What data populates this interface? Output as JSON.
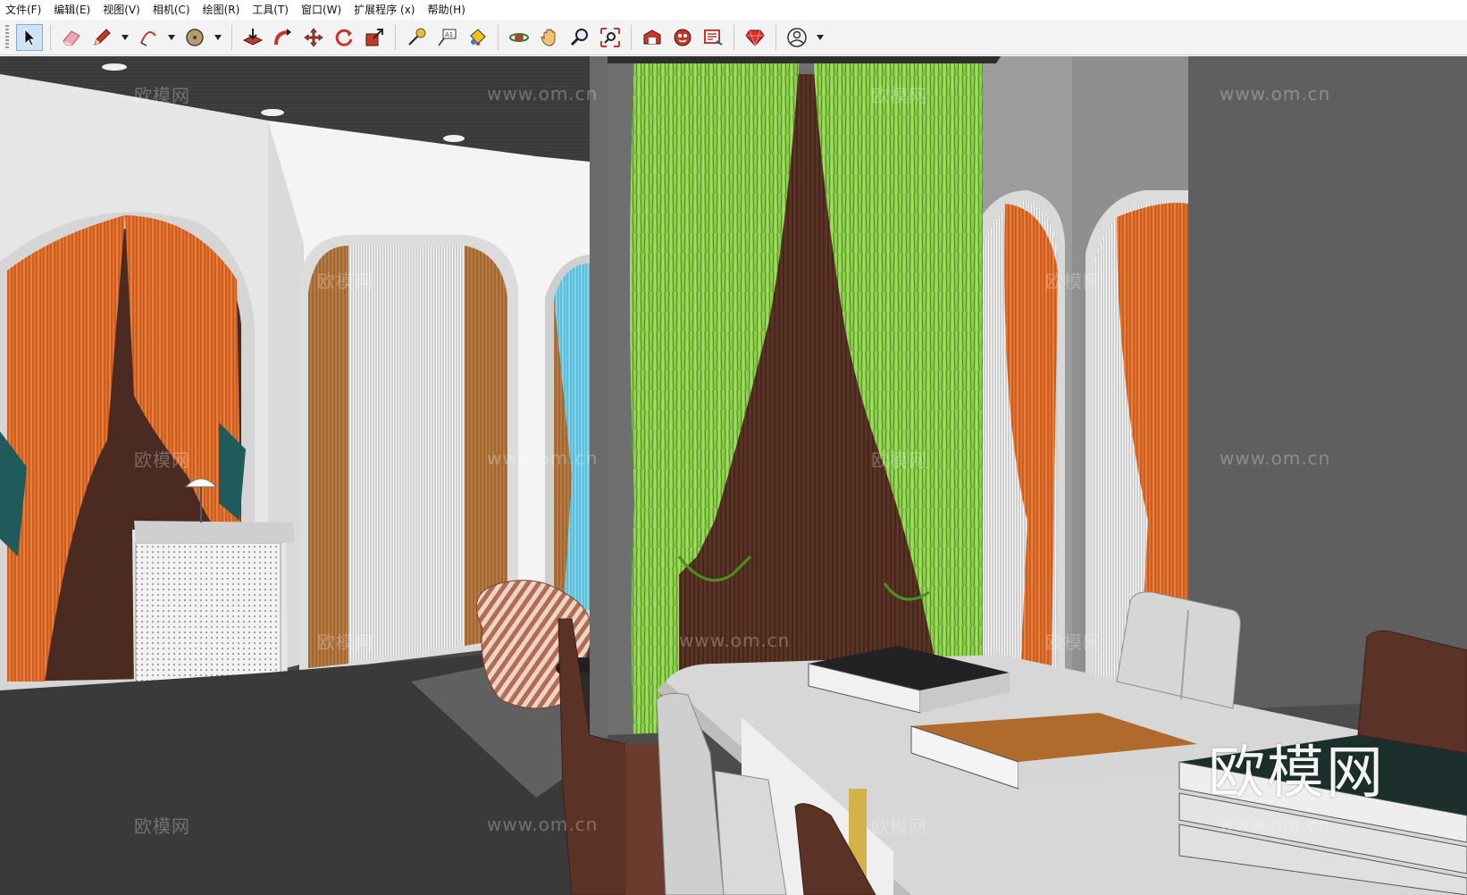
{
  "menu": [
    "文件(F)",
    "编辑(E)",
    "视图(V)",
    "相机(C)",
    "绘图(R)",
    "工具(T)",
    "窗口(W)",
    "扩展程序 (x)",
    "帮助(H)"
  ],
  "toolbar": {
    "tools": [
      "select",
      "eraser",
      "line",
      "arc",
      "shapes",
      "push-pull",
      "follow-me",
      "move",
      "rotate",
      "scale",
      "tape-measure",
      "text",
      "paint-bucket",
      "orbit",
      "pan",
      "zoom",
      "zoom-extents",
      "3d-warehouse",
      "extension-warehouse",
      "layout",
      "ruby-console",
      "account"
    ]
  },
  "watermarks": {
    "site": "www.om.cn",
    "brand_small": "欧模网",
    "brand_large": "欧模网"
  }
}
